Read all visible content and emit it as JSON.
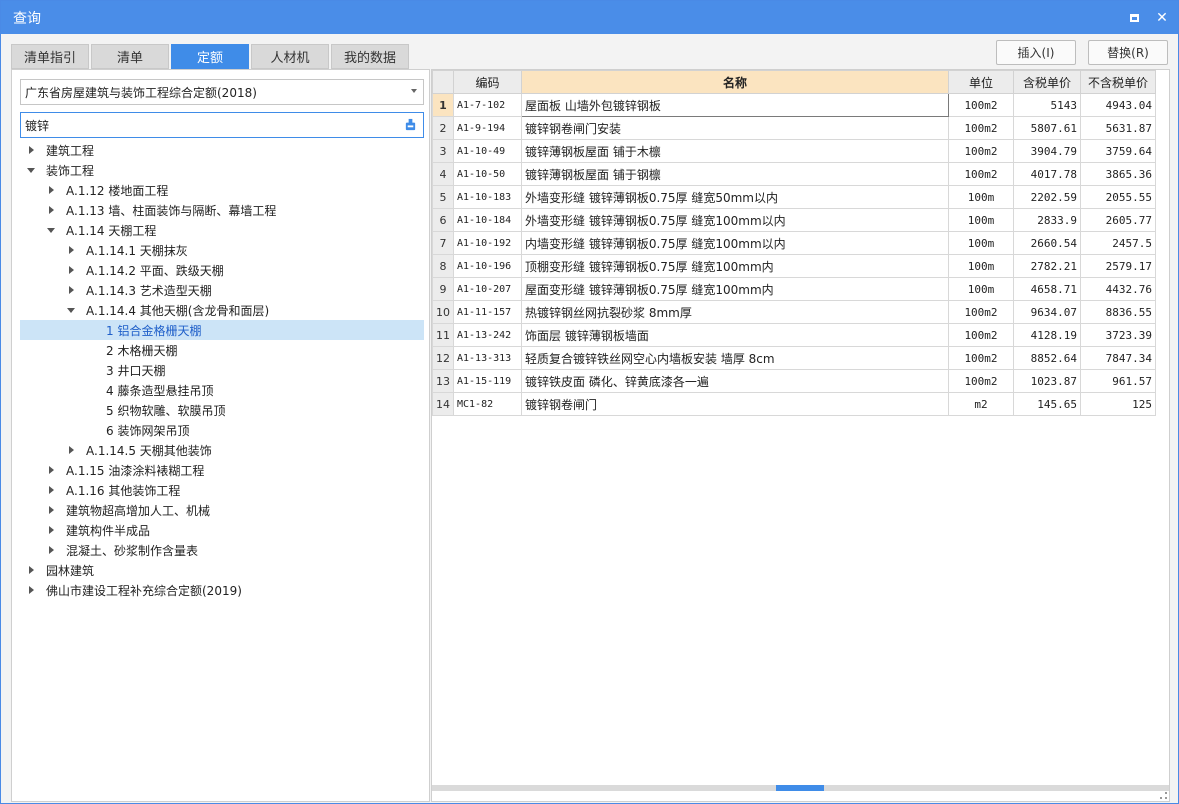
{
  "window": {
    "title": "查询"
  },
  "tabs": [
    "清单指引",
    "清单",
    "定额",
    "人材机",
    "我的数据"
  ],
  "active_tab": "定额",
  "actions": {
    "insert": "插入(I)",
    "replace": "替换(R)"
  },
  "quota_library": "广东省房屋建筑与装饰工程综合定额(2018)",
  "search": {
    "value": "镀锌"
  },
  "tree": [
    {
      "label": "建筑工程",
      "level": 0,
      "state": "collapsed"
    },
    {
      "label": "装饰工程",
      "level": 0,
      "state": "expanded"
    },
    {
      "label": "A.1.12 楼地面工程",
      "level": 1,
      "state": "collapsed"
    },
    {
      "label": "A.1.13 墙、柱面装饰与隔断、幕墙工程",
      "level": 1,
      "state": "collapsed"
    },
    {
      "label": "A.1.14 天棚工程",
      "level": 1,
      "state": "expanded"
    },
    {
      "label": "A.1.14.1 天棚抹灰",
      "level": 2,
      "state": "collapsed"
    },
    {
      "label": "A.1.14.2 平面、跌级天棚",
      "level": 2,
      "state": "collapsed"
    },
    {
      "label": "A.1.14.3 艺术造型天棚",
      "level": 2,
      "state": "collapsed"
    },
    {
      "label": "A.1.14.4 其他天棚(含龙骨和面层)",
      "level": 2,
      "state": "expanded"
    },
    {
      "label": "1 铝合金格栅天棚",
      "level": 3,
      "state": "leaf",
      "selected": true
    },
    {
      "label": "2 木格栅天棚",
      "level": 3,
      "state": "leaf"
    },
    {
      "label": "3 井口天棚",
      "level": 3,
      "state": "leaf"
    },
    {
      "label": "4 藤条造型悬挂吊顶",
      "level": 3,
      "state": "leaf"
    },
    {
      "label": "5 织物软雕、软膜吊顶",
      "level": 3,
      "state": "leaf"
    },
    {
      "label": "6 装饰网架吊顶",
      "level": 3,
      "state": "leaf"
    },
    {
      "label": "A.1.14.5 天棚其他装饰",
      "level": 2,
      "state": "collapsed"
    },
    {
      "label": "A.1.15 油漆涂料裱糊工程",
      "level": 1,
      "state": "collapsed"
    },
    {
      "label": "A.1.16 其他装饰工程",
      "level": 1,
      "state": "collapsed"
    },
    {
      "label": "建筑物超高增加人工、机械",
      "level": 1,
      "state": "collapsed"
    },
    {
      "label": "建筑构件半成品",
      "level": 1,
      "state": "collapsed"
    },
    {
      "label": "混凝土、砂浆制作含量表",
      "level": 1,
      "state": "collapsed"
    },
    {
      "label": "园林建筑",
      "level": 0,
      "state": "collapsed"
    },
    {
      "label": "佛山市建设工程补充综合定额(2019)",
      "level": 0,
      "state": "collapsed"
    }
  ],
  "table": {
    "headers": [
      "",
      "编码",
      "名称",
      "单位",
      "含税单价",
      "不含税单价"
    ],
    "rows": [
      [
        "1",
        "A1-7-102",
        "屋面板 山墙外包镀锌钢板",
        "100m2",
        "5143",
        "4943.04"
      ],
      [
        "2",
        "A1-9-194",
        "镀锌钢卷闸门安装",
        "100m2",
        "5807.61",
        "5631.87"
      ],
      [
        "3",
        "A1-10-49",
        "镀锌薄钢板屋面 铺于木檩",
        "100m2",
        "3904.79",
        "3759.64"
      ],
      [
        "4",
        "A1-10-50",
        "镀锌薄钢板屋面 铺于钢檩",
        "100m2",
        "4017.78",
        "3865.36"
      ],
      [
        "5",
        "A1-10-183",
        "外墙变形缝 镀锌薄钢板0.75厚 缝宽50mm以内",
        "100m",
        "2202.59",
        "2055.55"
      ],
      [
        "6",
        "A1-10-184",
        "外墙变形缝 镀锌薄钢板0.75厚 缝宽100mm以内",
        "100m",
        "2833.9",
        "2605.77"
      ],
      [
        "7",
        "A1-10-192",
        "内墙变形缝 镀锌薄钢板0.75厚 缝宽100mm以内",
        "100m",
        "2660.54",
        "2457.5"
      ],
      [
        "8",
        "A1-10-196",
        "顶棚变形缝 镀锌薄钢板0.75厚 缝宽100mm内",
        "100m",
        "2782.21",
        "2579.17"
      ],
      [
        "9",
        "A1-10-207",
        "屋面变形缝 镀锌薄钢板0.75厚 缝宽100mm内",
        "100m",
        "4658.71",
        "4432.76"
      ],
      [
        "10",
        "A1-11-157",
        "热镀锌钢丝网抗裂砂浆 8mm厚",
        "100m2",
        "9634.07",
        "8836.55"
      ],
      [
        "11",
        "A1-13-242",
        "饰面层 镀锌薄钢板墙面",
        "100m2",
        "4128.19",
        "3723.39"
      ],
      [
        "12",
        "A1-13-313",
        "轻质复合镀锌铁丝网空心内墙板安装 墙厚 8cm",
        "100m2",
        "8852.64",
        "7847.34"
      ],
      [
        "13",
        "A1-15-119",
        "镀锌铁皮面 磷化、锌黄底漆各一遍",
        "100m2",
        "1023.87",
        "961.57"
      ],
      [
        "14",
        "MC1-82",
        "镀锌钢卷闸门",
        "m2",
        "145.65",
        "125"
      ]
    ]
  },
  "colors": {
    "accent": "#3f8ce8",
    "title_bar": "#4a8de8",
    "header_highlight": "#fbe4c0",
    "selected_node": "#cce4f7"
  }
}
